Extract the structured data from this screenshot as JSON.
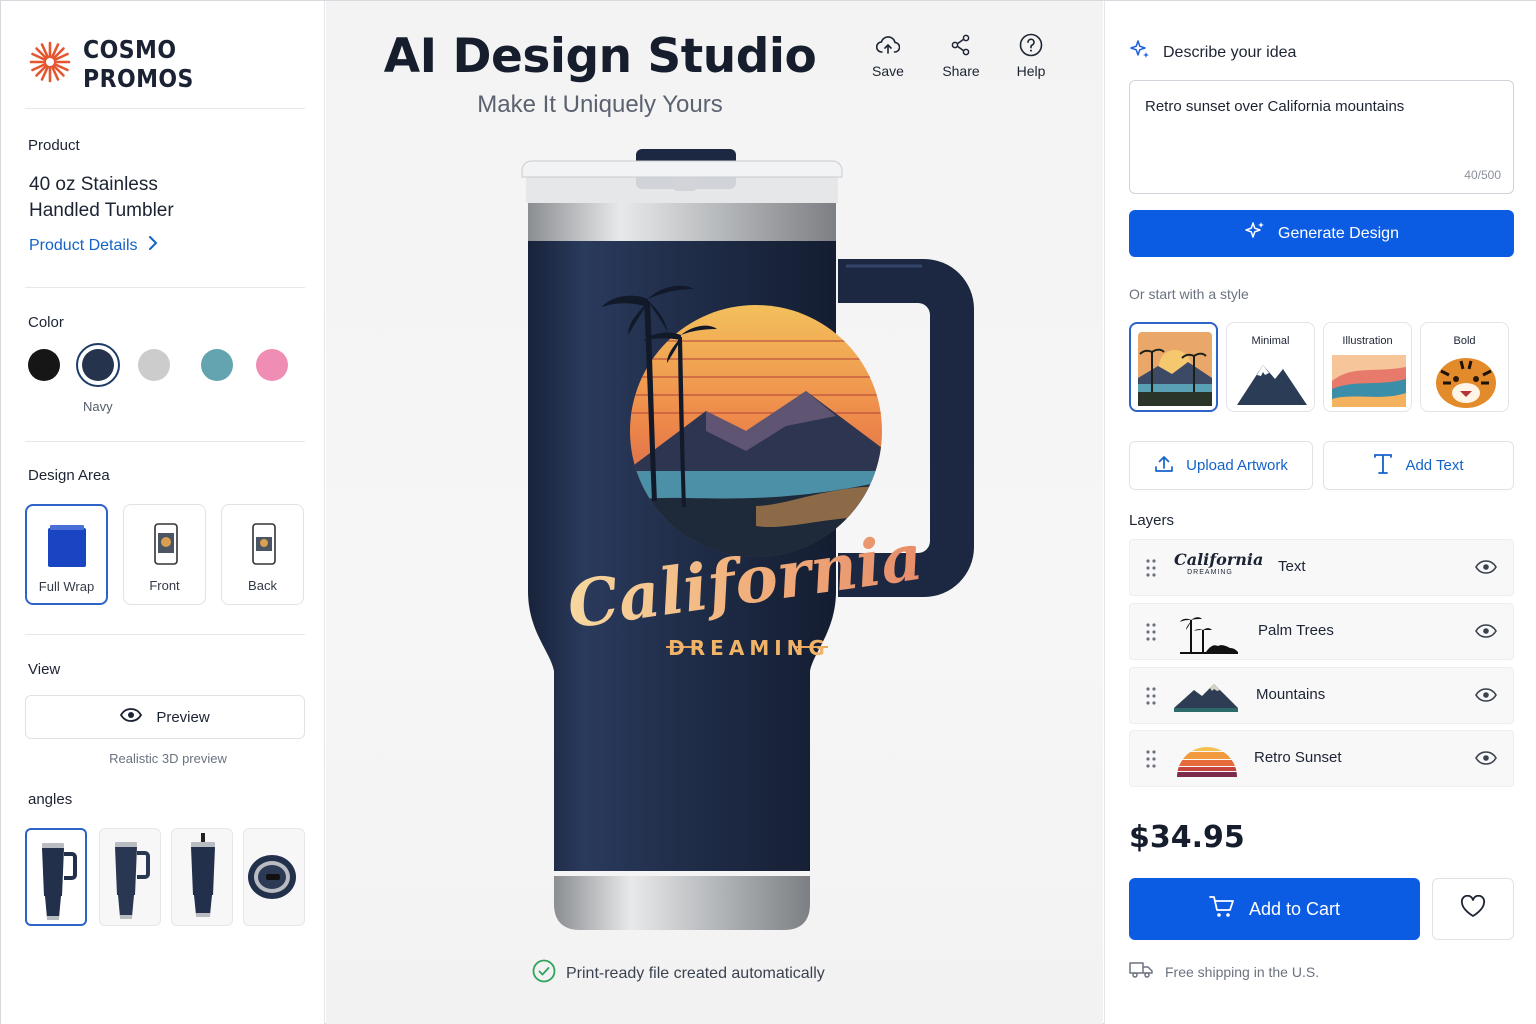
{
  "brand": {
    "name": "COSMO PROMOS"
  },
  "product": {
    "section_label": "Product",
    "name": "40 oz Stainless Handled Tumbler",
    "details_link": "Product Details"
  },
  "color": {
    "section_label": "Color",
    "selected_label": "Navy",
    "swatches": [
      {
        "name": "Black",
        "hex": "#161616"
      },
      {
        "name": "Navy",
        "hex": "#26334d"
      },
      {
        "name": "Gray",
        "hex": "#cccccc"
      },
      {
        "name": "Teal",
        "hex": "#63a4b0"
      },
      {
        "name": "Pink",
        "hex": "#f08db4"
      }
    ]
  },
  "design_area": {
    "section_label": "Design Area",
    "options": [
      "Full Wrap",
      "Front",
      "Back"
    ],
    "selected": "Full Wrap"
  },
  "view": {
    "section_label": "View",
    "preview_label": "Preview",
    "preview_note": "Realistic 3D preview"
  },
  "angles": {
    "section_label": "angles"
  },
  "header": {
    "title": "AI Design Studio",
    "subtitle": "Make It Uniquely Yours",
    "tools": [
      "Save",
      "Share",
      "Help"
    ]
  },
  "artwork": {
    "headline": "California",
    "tagline": "DREAMING"
  },
  "status": {
    "print_note": "Print-ready file created automatically"
  },
  "idea": {
    "label": "Describe your idea",
    "value": "Retro sunset over California mountains",
    "counter": "40/500"
  },
  "generate": {
    "label": "Generate Design"
  },
  "styles": {
    "intro": "Or start with a style",
    "options": [
      "Minimal",
      "Illustration",
      "Bold"
    ]
  },
  "actions": {
    "upload": "Upload Artwork",
    "add_text": "Add Text"
  },
  "layers": {
    "title": "Layers",
    "items": [
      "Text",
      "Palm Trees",
      "Mountains",
      "Retro Sunset"
    ],
    "text_thumb": "California",
    "text_thumb_sub": "DREAMING"
  },
  "purchase": {
    "price": "$34.95",
    "cart_label": "Add to Cart",
    "shipping": "Free shipping in the U.S."
  },
  "colors": {
    "accent": "#0b5ce3",
    "link": "#1463c9",
    "tumbler": "#1f2c47"
  }
}
